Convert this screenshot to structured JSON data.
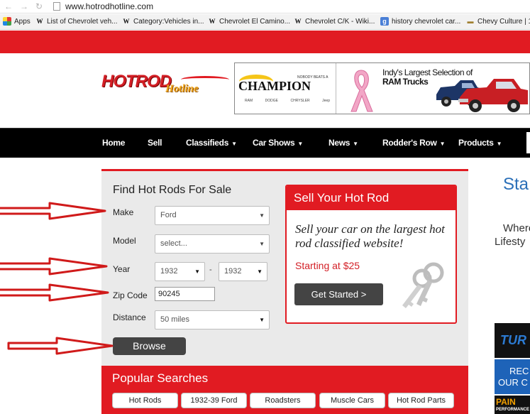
{
  "browser": {
    "url": "www.hotrodhotline.com",
    "bookmarks": [
      {
        "icon": "apps-icon",
        "label": "Apps"
      },
      {
        "icon": "wikipedia-icon",
        "label": "List of Chevrolet veh..."
      },
      {
        "icon": "wikipedia-icon",
        "label": "Category:Vehicles in..."
      },
      {
        "icon": "wikipedia-icon",
        "label": "Chevrolet El Camino..."
      },
      {
        "icon": "wikipedia-icon",
        "label": "Chevrolet C/K - Wiki..."
      },
      {
        "icon": "google-icon",
        "label": "history chevrolet car..."
      },
      {
        "icon": "car-icon",
        "label": "Chevy Culture | 1"
      }
    ]
  },
  "header": {
    "logo_main": "HOTROD",
    "logo_sub": "Hotline",
    "ad": {
      "tagline": "NOBODY BEATS A",
      "brand": "CHAMPION",
      "makes": [
        "RAM",
        "DODGE",
        "CHRYSLER",
        "Jeep"
      ],
      "headline": "Indy's Largest Selection of",
      "headline_bold": "RAM Trucks"
    }
  },
  "nav": {
    "items": [
      {
        "label": "Home",
        "dropdown": false
      },
      {
        "label": "Sell",
        "dropdown": false
      },
      {
        "label": "Classifieds",
        "dropdown": true
      },
      {
        "label": "Car Shows",
        "dropdown": true
      },
      {
        "label": "News",
        "dropdown": true
      },
      {
        "label": "Rodder's Row",
        "dropdown": true
      },
      {
        "label": "Products",
        "dropdown": true
      }
    ]
  },
  "search": {
    "title": "Find Hot Rods For Sale",
    "make_label": "Make",
    "make_value": "Ford",
    "model_label": "Model",
    "model_value": "select...",
    "year_label": "Year",
    "year_from": "1932",
    "year_sep": "-",
    "year_to": "1932",
    "zip_label": "Zip Code",
    "zip_value": "90245",
    "distance_label": "Distance",
    "distance_value": "50 miles",
    "browse_label": "Browse"
  },
  "sell": {
    "title": "Sell Your Hot Rod",
    "body": "Sell your car on the largest hot rod classified website!",
    "price": "Starting at $25",
    "button": "Get Started >"
  },
  "popular": {
    "title": "Popular Searches",
    "items": [
      "Hot Rods",
      "1932-39 Ford",
      "Roadsters",
      "Muscle Cars",
      "Hot Rod Parts"
    ]
  },
  "right": {
    "heading": "Sta",
    "line1": "Where",
    "line2": "Lifesty",
    "ad1": "TUR",
    "ad2": [
      "REC",
      "OUR C"
    ],
    "ad3": "PAIN",
    "ad3_sub": "PERFORMANCE"
  },
  "colors": {
    "brand_red": "#e11b22",
    "nav_bg": "#000000",
    "panel_bg": "#eaeaea",
    "button_dark": "#444444",
    "annotation_red": "#d01a1a"
  }
}
